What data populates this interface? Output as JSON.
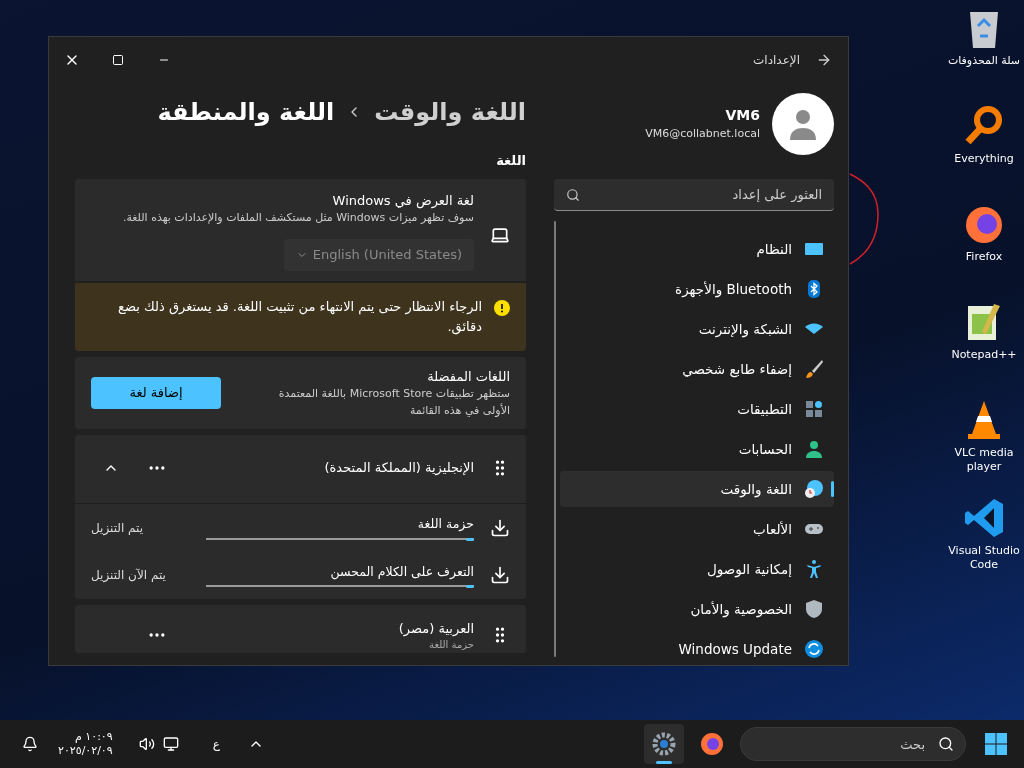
{
  "window": {
    "title": "الإعدادات",
    "breadcrumb": [
      "اللغة والوقت",
      "اللغة والمنطقة"
    ]
  },
  "profile": {
    "name": "VM6",
    "email": "VM6@collabnet.local"
  },
  "search": {
    "placeholder": "العثور على إعداد"
  },
  "nav": [
    {
      "label": "النظام",
      "selected": false
    },
    {
      "label": "Bluetooth والأجهزة",
      "selected": false
    },
    {
      "label": "الشبكة والإنترنت",
      "selected": false
    },
    {
      "label": "إضفاء طابع شخصي",
      "selected": false
    },
    {
      "label": "التطبيقات",
      "selected": false
    },
    {
      "label": "الحسابات",
      "selected": false
    },
    {
      "label": "اللغة والوقت",
      "selected": true
    },
    {
      "label": "الألعاب",
      "selected": false
    },
    {
      "label": "إمكانية الوصول",
      "selected": false
    },
    {
      "label": "الخصوصية والأمان",
      "selected": false
    },
    {
      "label": "Windows Update",
      "selected": false
    }
  ],
  "section_title": "اللغة",
  "display_language": {
    "title": "لغة العرض في Windows",
    "description": "سوف تظهر ميزات Windows مثل مستكشف الملفات والإعدادات بهذه اللغة.",
    "value": "English (United States)",
    "disabled": true
  },
  "warning": {
    "text": "الرجاء الانتظار حتى يتم الانتهاء من تثبيت اللغة. قد يستغرق ذلك بضع دقائق."
  },
  "preferred": {
    "title": "اللغات المفضلة",
    "description": "ستظهر تطبيقات Microsoft Store باللغة المعتمدة الأولى في هذه القائمة",
    "button": "إضافة لغة"
  },
  "languages": [
    {
      "name": "الإنجليزية (المملكة المتحدة)",
      "expanded": true,
      "downloads": [
        {
          "name": "حزمة اللغة",
          "status": "يتم التنزيل",
          "level": 0.03
        },
        {
          "name": "التعرف على الكلام المحسن",
          "status": "يتم الآن التنزيل",
          "level": 0.03
        }
      ]
    },
    {
      "name": "العربية (مصر)",
      "subtitle": "حزمة اللغة",
      "expanded": false
    }
  ],
  "desktop_icons": [
    {
      "label": "سلة المحذوفات"
    },
    {
      "label": "Everything"
    },
    {
      "label": "Firefox"
    },
    {
      "label": "Notepad++"
    },
    {
      "label": "VLC media player"
    },
    {
      "label": "Visual Studio Code"
    }
  ],
  "taskbar": {
    "search_placeholder": "بحث",
    "apps": [
      {
        "selected": false
      },
      {
        "selected": true
      }
    ],
    "language": "ع",
    "time": "١٠:٠٩ م",
    "date": "٢٠٢٥/٠٢/٠٩"
  }
}
